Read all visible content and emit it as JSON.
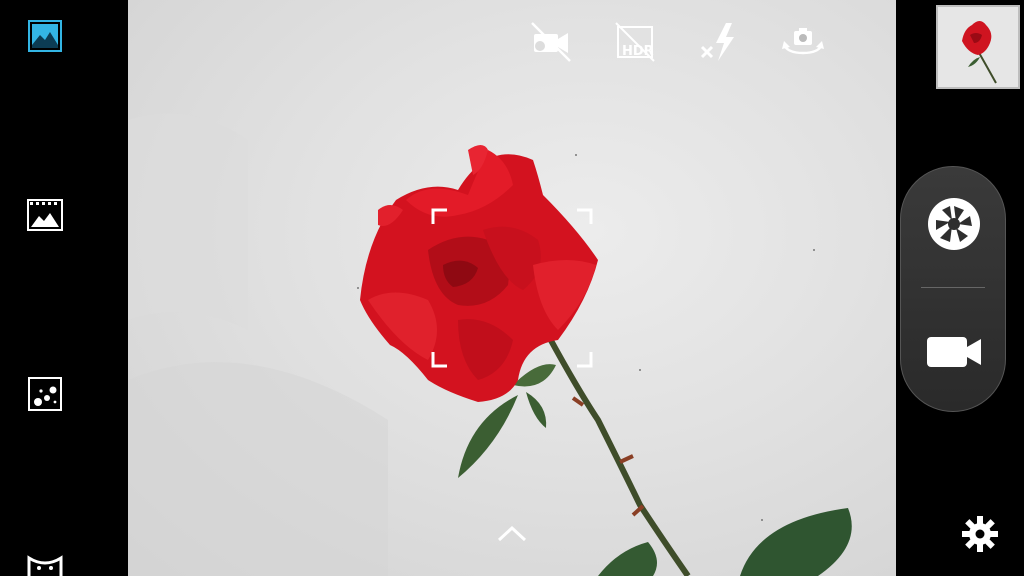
{
  "left_rail": {
    "modes": [
      {
        "name": "photo-mode",
        "icon": "landscape-photo-icon",
        "active": true
      },
      {
        "name": "panorama-mode",
        "icon": "panorama-film-icon",
        "active": false
      },
      {
        "name": "effects-mode",
        "icon": "bokeh-effect-icon",
        "active": false
      },
      {
        "name": "face-mode",
        "icon": "face-beauty-icon",
        "active": false
      }
    ],
    "accent_color": "#33b5e5"
  },
  "top_toolbar": {
    "buttons": [
      {
        "name": "video-off-toggle",
        "icon": "camcorder-off-icon"
      },
      {
        "name": "hdr-toggle",
        "icon": "hdr-off-icon",
        "label": "HDR"
      },
      {
        "name": "flash-toggle",
        "icon": "flash-off-icon"
      },
      {
        "name": "switch-camera",
        "icon": "switch-camera-icon"
      }
    ]
  },
  "viewfinder": {
    "subject": "red-rose",
    "focus_frame": "focus-brackets"
  },
  "right_panel": {
    "thumbnail": "last-photo-thumbnail",
    "shutter_icon": "shutter-aperture-icon",
    "video_icon": "video-record-icon",
    "settings_icon": "gear-icon"
  }
}
